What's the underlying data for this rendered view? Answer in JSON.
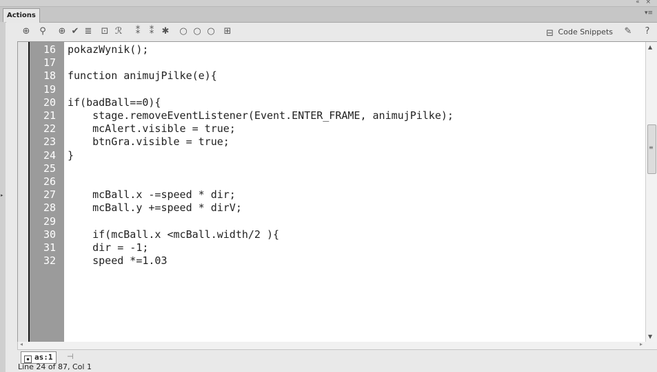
{
  "panel": {
    "title": "Actions",
    "window_controls": "«  ×",
    "menu_icon": "menu-icon"
  },
  "toolbar": {
    "code_snippets_label": "Code Snippets",
    "icons": [
      "add-statement-icon",
      "find-icon",
      "insert-target-path-icon",
      "check-syntax-icon",
      "auto-format-icon",
      "show-code-hint-icon",
      "debug-options-icon",
      "collapse-between-braces-icon",
      "collapse-selection-icon",
      "expand-all-icon",
      "apply-block-comment-icon",
      "apply-line-comment-icon",
      "remove-comment-icon",
      "show-hide-toolbox-icon",
      "code-snippets-icon",
      "wizard-icon",
      "help-icon"
    ]
  },
  "editor": {
    "lines": [
      {
        "n": "16",
        "code": "pokazWynik();"
      },
      {
        "n": "17",
        "code": ""
      },
      {
        "n": "18",
        "code": "function animujPilke(e){"
      },
      {
        "n": "19",
        "code": ""
      },
      {
        "n": "20",
        "code": "if(badBall==0){"
      },
      {
        "n": "21",
        "code": "    stage.removeEventListener(Event.ENTER_FRAME, animujPilke);"
      },
      {
        "n": "22",
        "code": "    mcAlert.visible = true;"
      },
      {
        "n": "23",
        "code": "    btnGra.visible = true;"
      },
      {
        "n": "24",
        "code": "}"
      },
      {
        "n": "25",
        "code": ""
      },
      {
        "n": "26",
        "code": ""
      },
      {
        "n": "27",
        "code": "    mcBall.x -=speed * dir;"
      },
      {
        "n": "28",
        "code": "    mcBall.y +=speed * dirV;"
      },
      {
        "n": "29",
        "code": ""
      },
      {
        "n": "30",
        "code": "    if(mcBall.x <mcBall.width/2 ){"
      },
      {
        "n": "31",
        "code": "    dir = -1;"
      },
      {
        "n": "32",
        "code": "    speed *=1.03"
      }
    ]
  },
  "file_tab": {
    "label": "as:1"
  },
  "status": {
    "text": "Line 24 of 87, Col 1"
  }
}
